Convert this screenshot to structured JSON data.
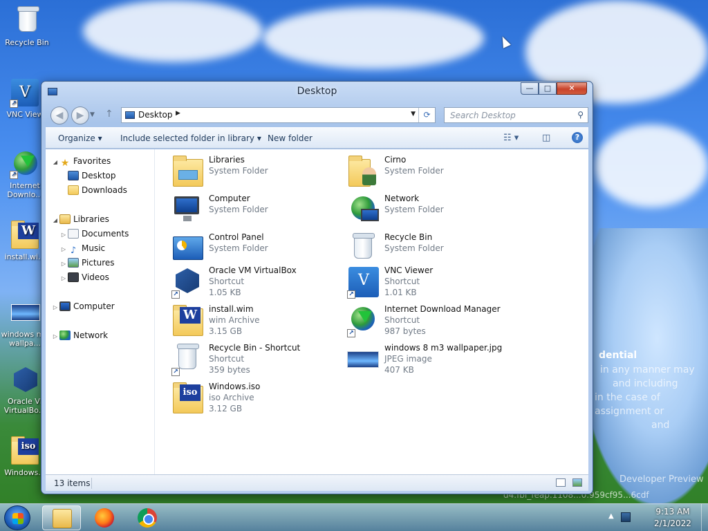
{
  "desktop": {
    "icons": [
      {
        "label": "Recycle Bin",
        "icon": "recycle-bin-icon"
      },
      {
        "label": "VNC View",
        "icon": "vnc-viewer-icon"
      },
      {
        "label": "Internet Downlo...",
        "icon": "internet-download-manager-icon"
      },
      {
        "label": "install.wi...",
        "icon": "wim-archive-icon"
      },
      {
        "label": "windows m3 wallpa...",
        "icon": "image-icon"
      },
      {
        "label": "Oracle VI VirtualBo...",
        "icon": "virtualbox-icon"
      },
      {
        "label": "Windows...",
        "icon": "iso-archive-icon"
      }
    ],
    "wallpaper_text": [
      "dential",
      "in any manner may",
      "and including",
      "in the case of",
      "assignment or",
      "and",
      "Developer Preview",
      "d4.fbl_feap.1108...0.959cf95...6cdf"
    ]
  },
  "window": {
    "title": "Desktop",
    "controls": {
      "minimize": "—",
      "maximize": "□",
      "close": "✕"
    },
    "address": {
      "location": "Desktop"
    },
    "search": {
      "placeholder": "Search Desktop"
    },
    "toolbar": {
      "organize": "Organize",
      "include_library": "Include selected folder in library",
      "new_folder": "New folder",
      "help": "?"
    },
    "nav_pane": {
      "favorites": {
        "label": "Favorites",
        "items": [
          "Desktop",
          "Downloads"
        ]
      },
      "libraries": {
        "label": "Libraries",
        "items": [
          "Documents",
          "Music",
          "Pictures",
          "Videos"
        ]
      },
      "computer": "Computer",
      "network": "Network"
    },
    "files": [
      {
        "name": "Libraries",
        "type": "System Folder",
        "size": "",
        "icon": "libraries-icon"
      },
      {
        "name": "Cirno",
        "type": "System Folder",
        "size": "",
        "icon": "user-folder-icon"
      },
      {
        "name": "Computer",
        "type": "System Folder",
        "size": "",
        "icon": "computer-icon"
      },
      {
        "name": "Network",
        "type": "System Folder",
        "size": "",
        "icon": "network-icon"
      },
      {
        "name": "Control Panel",
        "type": "System Folder",
        "size": "",
        "icon": "control-panel-icon"
      },
      {
        "name": "Recycle Bin",
        "type": "System Folder",
        "size": "",
        "icon": "recycle-bin-icon"
      },
      {
        "name": "Oracle VM VirtualBox",
        "type": "Shortcut",
        "size": "1.05 KB",
        "icon": "virtualbox-icon"
      },
      {
        "name": "VNC Viewer",
        "type": "Shortcut",
        "size": "1.01 KB",
        "icon": "vnc-viewer-icon"
      },
      {
        "name": "install.wim",
        "type": "wim Archive",
        "size": "3.15 GB",
        "icon": "wim-archive-icon"
      },
      {
        "name": "Internet Download Manager",
        "type": "Shortcut",
        "size": "987 bytes",
        "icon": "internet-download-manager-icon"
      },
      {
        "name": "Recycle Bin - Shortcut",
        "type": "Shortcut",
        "size": "359 bytes",
        "icon": "recycle-bin-icon"
      },
      {
        "name": "windows 8 m3 wallpaper.jpg",
        "type": "JPEG image",
        "size": "407 KB",
        "icon": "image-icon"
      },
      {
        "name": "Windows.iso",
        "type": "iso Archive",
        "size": "3.12 GB",
        "icon": "iso-archive-icon"
      }
    ],
    "status": {
      "item_count": "13 items"
    }
  },
  "taskbar": {
    "clock": {
      "time": "9:13 AM",
      "date": "2/1/2022"
    },
    "pinned": [
      "Windows Explorer",
      "Firefox",
      "Chrome"
    ]
  }
}
